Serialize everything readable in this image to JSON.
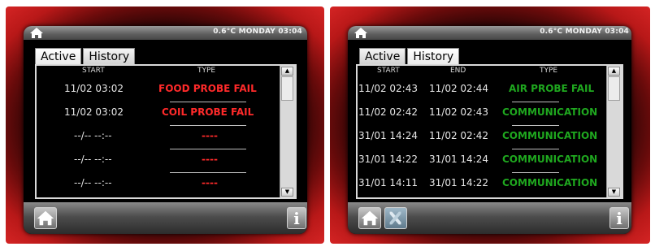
{
  "left": {
    "status": "0.6°C MONDAY 03:04",
    "tabs": [
      "Active",
      "History"
    ],
    "columns": {
      "start": "START",
      "type": "TYPE"
    },
    "rows": [
      {
        "start": "11/02 03:02",
        "type": "FOOD PROBE FAIL"
      },
      {
        "start": "11/02 03:02",
        "type": "COIL PROBE FAIL"
      },
      {
        "start": "--/-- --:--",
        "type": "----"
      },
      {
        "start": "--/-- --:--",
        "type": "----"
      },
      {
        "start": "--/-- --:--",
        "type": "----"
      }
    ],
    "info_label": "i"
  },
  "right": {
    "status": "0.6°C MONDAY 03:04",
    "tabs": [
      "Active",
      "History"
    ],
    "columns": {
      "start": "START",
      "end": "END",
      "type": "TYPE"
    },
    "rows": [
      {
        "start": "11/02 02:43",
        "end": "11/02 02:44",
        "type": "AIR PROBE FAIL"
      },
      {
        "start": "11/02 02:42",
        "end": "11/02 02:43",
        "type": "COMMUNICATION"
      },
      {
        "start": "31/01 14:24",
        "end": "11/02 02:42",
        "type": "COMMUNICATION"
      },
      {
        "start": "31/01 14:22",
        "end": "31/01 14:24",
        "type": "COMMUNICATION"
      },
      {
        "start": "31/01 14:11",
        "end": "31/01 14:22",
        "type": "COMMUNICATION"
      }
    ],
    "info_label": "i"
  },
  "colors": {
    "alarm_red": "#ff2a2a",
    "alarm_green": "#1fa81f",
    "frame_red": "#d42424"
  },
  "icons": [
    "home-icon",
    "wrench-icon",
    "info-icon",
    "scroll-up-icon",
    "scroll-down-icon"
  ]
}
